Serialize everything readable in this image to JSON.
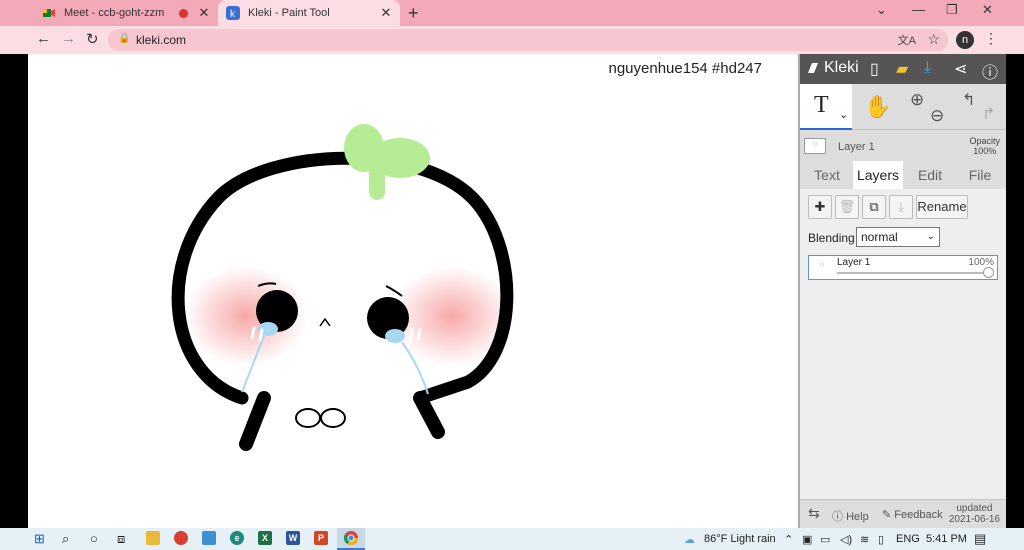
{
  "browser": {
    "tabs": [
      {
        "title": "Meet - ccb-goht-zzm",
        "active": false
      },
      {
        "title": "Kleki - Paint Tool",
        "active": true
      }
    ],
    "new_tab": "+",
    "url": "kleki.com",
    "avatar_letter": "n"
  },
  "canvas": {
    "credit": "nguyenhue154  #hd247"
  },
  "panel": {
    "logo": "Kleki",
    "layer_name": "Layer 1",
    "opacity_label": "Opacity",
    "opacity_value": "100%",
    "tabs": [
      "Text",
      "Layers",
      "Edit",
      "File"
    ],
    "active_tab": "Layers",
    "layer_buttons": {
      "rename": "Rename"
    },
    "blending_label": "Blending",
    "blending_value": "normal",
    "layers": [
      {
        "name": "Layer 1",
        "opacity": "100%",
        "opacity_fraction": 1.0
      }
    ],
    "footer": {
      "help": "Help",
      "feedback": "Feedback",
      "updated": "updated",
      "date": "2021-06-16"
    }
  },
  "taskbar": {
    "weather": "86°F  Light rain",
    "lang": "ENG",
    "time": "5:41 PM"
  }
}
